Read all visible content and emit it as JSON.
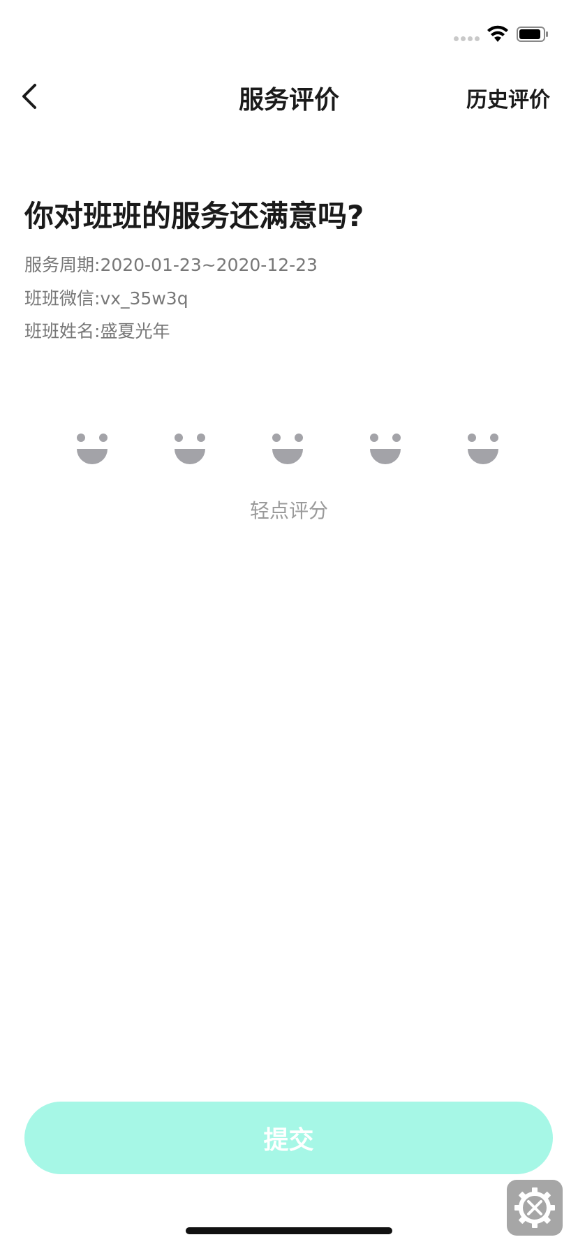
{
  "nav": {
    "title": "服务评价",
    "right_label": "历史评价"
  },
  "question": "你对班班的服务还满意吗?",
  "info": [
    {
      "label": "服务周期:",
      "value": "2020-01-23~2020-12-23"
    },
    {
      "label": "班班微信:",
      "value": "vx_35w3q"
    },
    {
      "label": "班班姓名:",
      "value": "盛夏光年"
    }
  ],
  "rating": {
    "faces": [
      "smile-face-icon",
      "smile-face-icon",
      "smile-face-icon",
      "smile-face-icon",
      "smile-face-icon"
    ],
    "hint": "轻点评分"
  },
  "submit_label": "提交",
  "colors": {
    "accent": "#a6f7e6",
    "face": "#a3a3a8",
    "muted_text": "#777777"
  },
  "icons": {
    "back": "chevron-left-icon",
    "wifi": "wifi-icon",
    "battery": "battery-icon",
    "tools": "gear-icon"
  }
}
